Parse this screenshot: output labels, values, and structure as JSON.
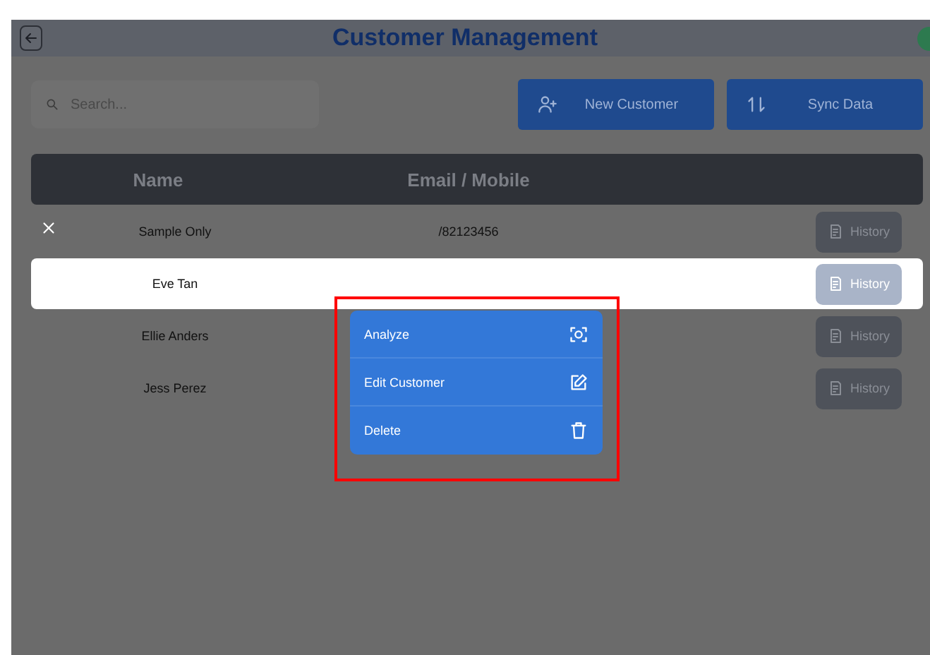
{
  "header": {
    "title": "Customer Management"
  },
  "search": {
    "placeholder": "Search..."
  },
  "actions": [
    {
      "label": "New Customer",
      "kind": "add"
    },
    {
      "label": "Sync Data",
      "kind": "sync"
    }
  ],
  "table": {
    "columns": [
      "Name",
      "Email / Mobile"
    ],
    "rows": [
      {
        "name": "Sample Only",
        "contact": "/82123456",
        "closable": true,
        "selected": false,
        "action": "History"
      },
      {
        "name": "Eve Tan",
        "contact": "",
        "closable": false,
        "selected": true,
        "action": "History"
      },
      {
        "name": "Ellie Anders",
        "contact": "",
        "closable": false,
        "selected": false,
        "action": "History"
      },
      {
        "name": "Jess Perez",
        "contact": "",
        "closable": false,
        "selected": false,
        "action": "History"
      }
    ]
  },
  "context_menu": {
    "items": [
      {
        "label": "Analyze",
        "kind": "analyze"
      },
      {
        "label": "Edit Customer",
        "kind": "edit"
      },
      {
        "label": "Delete",
        "kind": "delete"
      }
    ]
  }
}
